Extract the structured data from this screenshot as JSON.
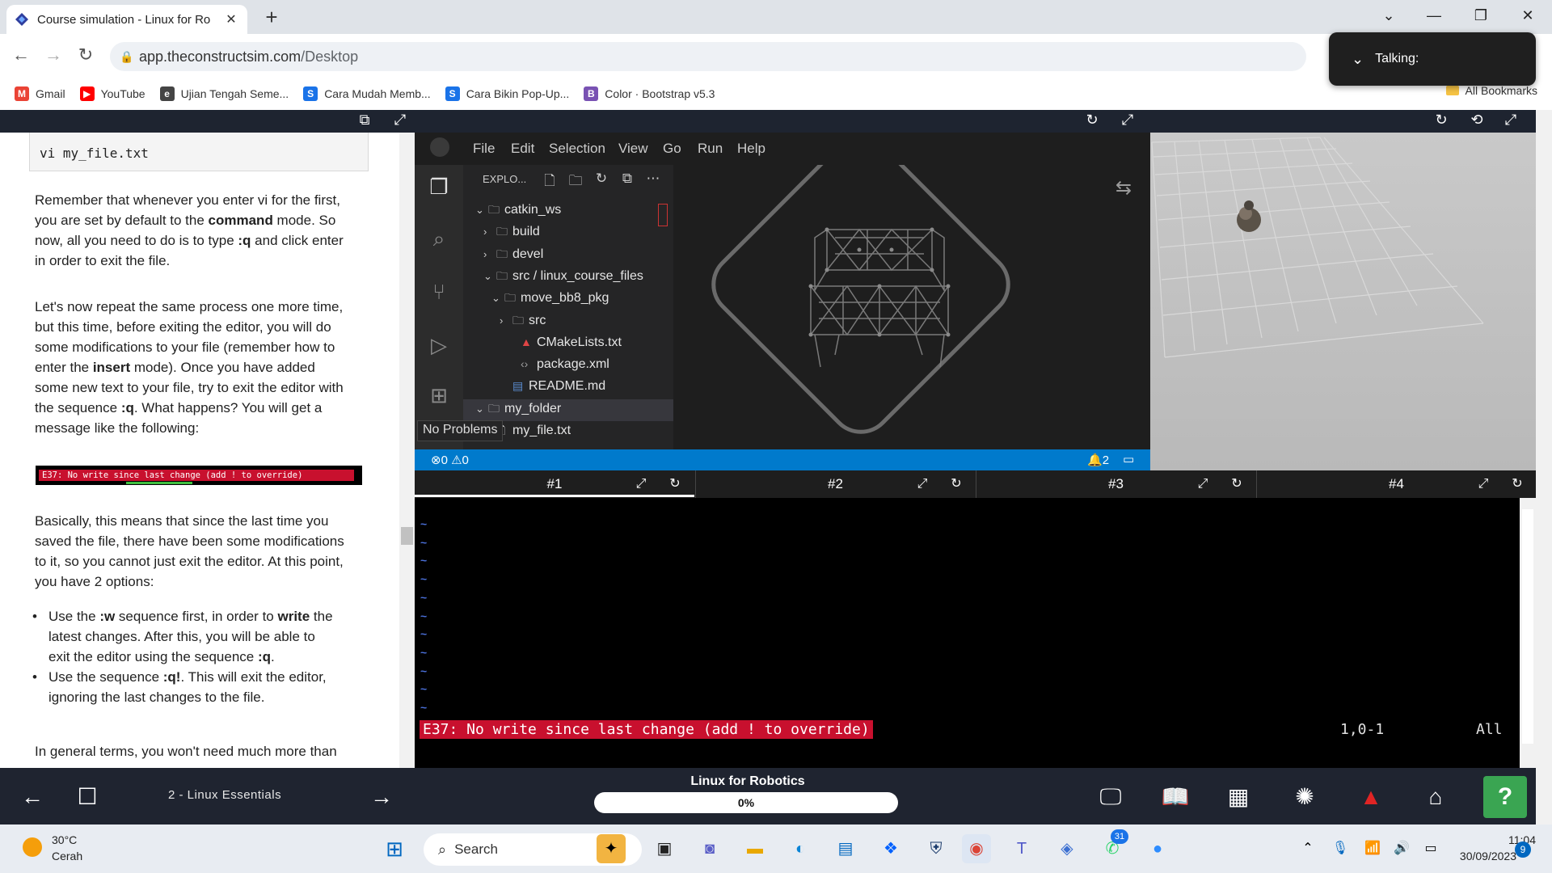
{
  "browser": {
    "tab_title": "Course simulation - Linux for Ro",
    "tab_close": "✕",
    "new_tab": "+",
    "url_host": "app.theconstructsim.com",
    "url_path": "/Desktop",
    "bookmarks": [
      {
        "label": "Gmail",
        "icon": "M",
        "color": "#ea4335"
      },
      {
        "label": "YouTube",
        "icon": "▶",
        "color": "#ff0000"
      },
      {
        "label": "Ujian Tengah Seme...",
        "icon": "e",
        "color": "#444444"
      },
      {
        "label": "Cara Mudah Memb...",
        "icon": "S",
        "color": "#1a73e8"
      },
      {
        "label": "Cara Bikin Pop-Up...",
        "icon": "S",
        "color": "#1a73e8"
      },
      {
        "label": "Color · Bootstrap v5.3",
        "icon": "B",
        "color": "#7952b3"
      }
    ],
    "all_bookmarks": "All Bookmarks",
    "talking": "Talking:"
  },
  "notebook": {
    "code": "vi my_file.txt",
    "p1": [
      "Remember that whenever you enter vi for the first,",
      "you are set by default to the ",
      "command",
      " mode. So",
      "now, all you need to do is to type ",
      ":q",
      " and click enter",
      "in order to exit the file."
    ],
    "p2_lines": [
      "Let's now repeat the same process one more time,",
      "but this time, before exiting the editor, you will do",
      "some modifications to your file (remember how to"
    ],
    "p2_insert_pre": "enter the ",
    "p2_insert_b": "insert",
    "p2_insert_post": " mode). Once you have added",
    "p2_line5": "some new text to your file, try to exit the editor with",
    "p2_line6_pre": "the sequence ",
    "p2_line6_b": ":q",
    "p2_line6_post": ". What happens? You will get a",
    "p2_line7": "message like the following:",
    "error_image_text": "E37: No write since last change (add ! to override)",
    "p3_lines": [
      "Basically, this means that since the last time you",
      "saved the file, there have been some modifications",
      "to it, so you cannot just exit the editor. At this point,",
      "you have 2 options:"
    ],
    "b1_pre": "Use the ",
    "b1_b1": ":w",
    "b1_mid": " sequence first, in order to ",
    "b1_b2": "write",
    "b1_post": " the",
    "b1_line2": "latest changes. After this, you will be able to",
    "b1_line3_pre": "exit the editor using the sequence ",
    "b1_line3_b": ":q",
    "b1_line3_post": ".",
    "b2_pre": "Use the sequence ",
    "b2_b": ":q!",
    "b2_post": ". This will exit the editor,",
    "b2_line2": "ignoring the last changes to the file.",
    "p4": "In general terms, you won't need much more than"
  },
  "vscode": {
    "menu": [
      "File",
      "Edit",
      "Selection",
      "View",
      "Go",
      "Run",
      "Help"
    ],
    "explorer_title": "EXPLO...",
    "tree": [
      {
        "label": "catkin_ws",
        "indent": 0,
        "arrow": "⌄",
        "kind": "folder"
      },
      {
        "label": "build",
        "indent": 1,
        "arrow": "›",
        "kind": "folder"
      },
      {
        "label": "devel",
        "indent": 1,
        "arrow": "›",
        "kind": "folder"
      },
      {
        "label": "src / linux_course_files",
        "indent": 1,
        "arrow": "⌄",
        "kind": "folder"
      },
      {
        "label": "move_bb8_pkg",
        "indent": 2,
        "arrow": "⌄",
        "kind": "folder"
      },
      {
        "label": "src",
        "indent": 3,
        "arrow": "›",
        "kind": "folder"
      },
      {
        "label": "CMakeLists.txt",
        "indent": 4,
        "arrow": "",
        "kind": "cmake"
      },
      {
        "label": "package.xml",
        "indent": 4,
        "arrow": "",
        "kind": "xml"
      },
      {
        "label": "README.md",
        "indent": 3,
        "arrow": "",
        "kind": "md"
      },
      {
        "label": "my_folder",
        "indent": 0,
        "arrow": "⌄",
        "kind": "folder"
      },
      {
        "label": "my_file.txt",
        "indent": 1,
        "arrow": "",
        "kind": "file"
      }
    ],
    "tooltip": "No Problems",
    "status_errors": "0",
    "status_warnings": "0",
    "status_notifications": "2"
  },
  "terminal": {
    "tabs": [
      "#1",
      "#2",
      "#3",
      "#4"
    ],
    "tilde_count": 11,
    "error": "E37: No write since last change (add ! to override)",
    "position": "1,0-1",
    "scroll": "All"
  },
  "appbar": {
    "chapter": "2 - Linux Essentials",
    "course": "Linux for Robotics",
    "progress_label": "0%",
    "progress_value": 0,
    "help": "?"
  },
  "taskbar": {
    "temp": "30°C",
    "weather": "Cerah",
    "search": "Search",
    "teams_badge": "31",
    "time": "11:04",
    "date": "30/09/2023",
    "notifications": "9"
  },
  "colors": {
    "accent": "#007acc",
    "error": "#c8102e",
    "help": "#3aa552"
  }
}
